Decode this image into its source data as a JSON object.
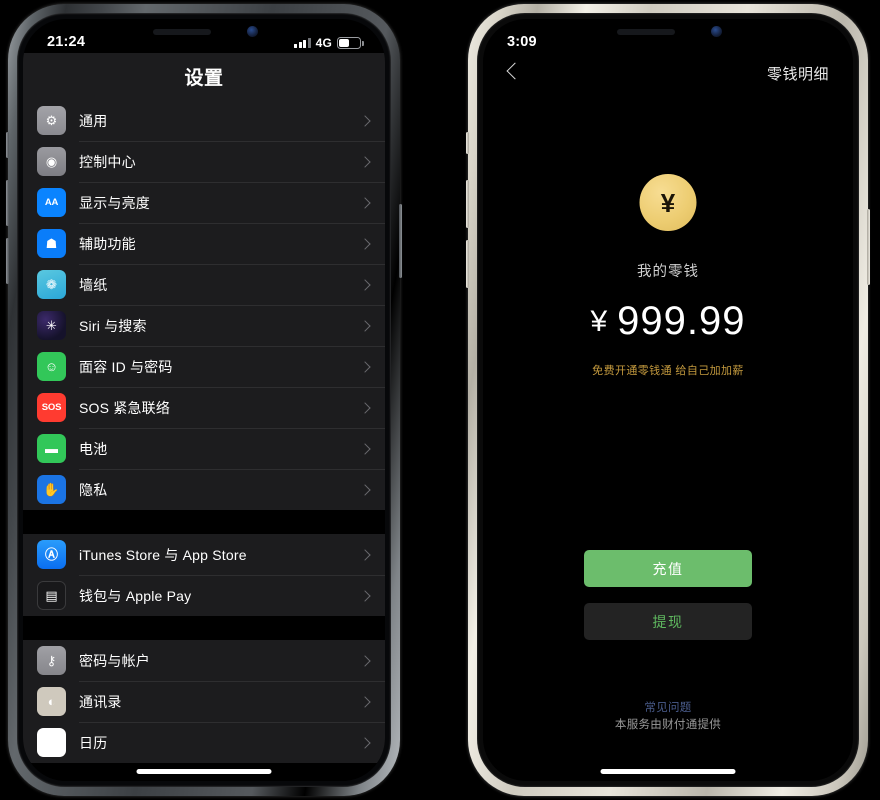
{
  "left_phone": {
    "frame_color": "#4c5054",
    "status_bar": {
      "time": "21:24",
      "network": "4G",
      "signal_icon": "signal-bars-icon",
      "battery_icon": "battery-icon",
      "battery_level": 45
    },
    "nav": {
      "title": "设置"
    },
    "groups": [
      {
        "rows": [
          {
            "label": "通用",
            "icon": "gear-icon",
            "icon_class": "ic-gear",
            "glyph": "⚙",
            "chevron": "chevron-right-icon"
          },
          {
            "label": "控制中心",
            "icon": "control-center-icon",
            "icon_class": "ic-cc",
            "glyph": "◉",
            "chevron": "chevron-right-icon"
          },
          {
            "label": "显示与亮度",
            "icon": "display-brightness-icon",
            "icon_class": "ic-blue",
            "glyph": "AA",
            "chevron": "chevron-right-icon"
          },
          {
            "label": "辅助功能",
            "icon": "accessibility-icon",
            "icon_class": "ic-access",
            "glyph": "☗",
            "chevron": "chevron-right-icon"
          },
          {
            "label": "墙纸",
            "icon": "wallpaper-icon",
            "icon_class": "ic-wall",
            "glyph": "❁",
            "chevron": "chevron-right-icon"
          },
          {
            "label": "Siri 与搜索",
            "icon": "siri-icon",
            "icon_class": "ic-siri",
            "glyph": "✳",
            "chevron": "chevron-right-icon"
          },
          {
            "label": "面容 ID 与密码",
            "icon": "face-id-icon",
            "icon_class": "ic-green",
            "glyph": "☺",
            "chevron": "chevron-right-icon"
          },
          {
            "label": "SOS 紧急联络",
            "icon": "sos-icon",
            "icon_class": "ic-sos",
            "glyph": "SOS",
            "chevron": "chevron-right-icon"
          },
          {
            "label": "电池",
            "icon": "battery-settings-icon",
            "icon_class": "ic-green",
            "glyph": "▬",
            "chevron": "chevron-right-icon"
          },
          {
            "label": "隐私",
            "icon": "privacy-hand-icon",
            "icon_class": "ic-hand",
            "glyph": "✋",
            "chevron": "chevron-right-icon"
          }
        ]
      },
      {
        "rows": [
          {
            "label": "iTunes Store 与 App Store",
            "icon": "app-store-icon",
            "icon_class": "ic-appstore",
            "glyph": "Ⓐ",
            "chevron": "chevron-right-icon"
          },
          {
            "label": "钱包与 Apple Pay",
            "icon": "wallet-icon",
            "icon_class": "ic-wallet",
            "glyph": "▤",
            "chevron": "chevron-right-icon"
          }
        ]
      },
      {
        "rows": [
          {
            "label": "密码与帐户",
            "icon": "key-icon",
            "icon_class": "ic-key",
            "glyph": "⚷",
            "chevron": "chevron-right-icon"
          },
          {
            "label": "通讯录",
            "icon": "contacts-icon",
            "icon_class": "ic-contacts",
            "glyph": "◐",
            "chevron": "chevron-right-icon"
          },
          {
            "label": "日历",
            "icon": "calendar-icon",
            "icon_class": "ic-cal",
            "glyph": "▦",
            "chevron": "chevron-right-icon"
          }
        ]
      }
    ]
  },
  "right_phone": {
    "frame_color": "#e8e4da",
    "status_bar": {
      "time": "3:09"
    },
    "nav": {
      "back_icon": "chevron-left-icon",
      "title": "零钱明细"
    },
    "wallet": {
      "coin_icon": "yen-coin-icon",
      "coin_symbol": "¥",
      "subtitle": "我的零钱",
      "currency_symbol": "¥",
      "amount": "999.99",
      "promo": "免费开通零钱通 给自己加加薪",
      "primary_button": "充值",
      "secondary_button": "提现",
      "faq_link": "常见问题",
      "provider": "本服务由财付通提供",
      "accent_green": "#6cbd6c",
      "accent_gold": "#c49a3e"
    }
  }
}
